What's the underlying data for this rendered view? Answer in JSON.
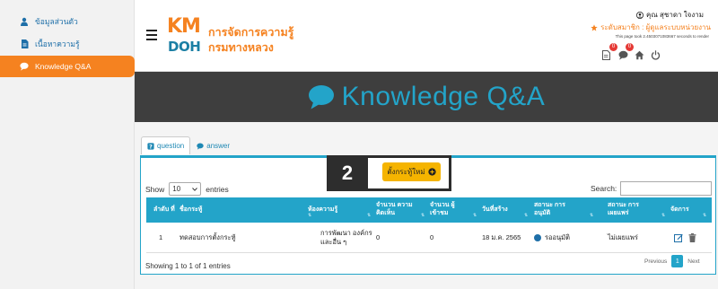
{
  "sidebar": {
    "items": [
      {
        "label": "ข้อมูลส่วนตัว",
        "icon": "user-icon"
      },
      {
        "label": "เนื้อหาความรู้",
        "icon": "document-icon"
      },
      {
        "label": "Knowledge Q&A",
        "icon": "chat-bubble-icon",
        "active": true
      }
    ]
  },
  "header": {
    "logo_km": "KM",
    "logo_doh": "DOH",
    "brand_line1": "การจัดการความรู้",
    "brand_line2": "กรมทางหลวง",
    "user_name": "คุณ สุชาดา ใจงาม",
    "role": "ระดับสมาชิก : ผู้ดูแลระบบหน่วยงาน",
    "generation_text": "This page took 2.4503071083667 seconds to render",
    "badges": {
      "document": "0",
      "chat": "0"
    }
  },
  "banner": {
    "title": "Knowledge Q&A"
  },
  "tabs": [
    {
      "label": "question",
      "icon": "question-icon",
      "active": true
    },
    {
      "label": "answer",
      "icon": "chat-bubble-icon",
      "active": false
    }
  ],
  "step_marker": "2",
  "new_topic_button": "ตั้งกระทู้ใหม่",
  "table_controls": {
    "show": "Show",
    "page_size": "10",
    "entries": "entries",
    "search_label": "Search:"
  },
  "table": {
    "headers": [
      "ลำดับ ที่",
      "ชื่อกระทู้",
      "ห้องความรู้",
      "จำนวน ความคิดเห็น",
      "จำนวน ผู้เข้าชม",
      "วันที่สร้าง",
      "สถานะ การอนุมัติ",
      "สถานะ การเผยแพร่",
      "จัดการ"
    ],
    "rows": [
      {
        "no": "1",
        "title": "ทดสอบการตั้งกระทู้",
        "room": "การพัฒนา องค์กรและอื่น ๆ",
        "comments": "0",
        "views": "0",
        "created": "18 ม.ค. 2565",
        "approval": "รออนุมัติ",
        "publish": "ไม่เผยแพร่"
      }
    ]
  },
  "footer": {
    "info": "Showing 1 to 1 of 1 entries",
    "previous": "Previous",
    "page": "1",
    "next": "Next"
  },
  "colors": {
    "accent": "#23a4c9",
    "orange": "#f58220",
    "banner_bg": "#3e3e3e",
    "button_yellow": "#f5b400"
  }
}
